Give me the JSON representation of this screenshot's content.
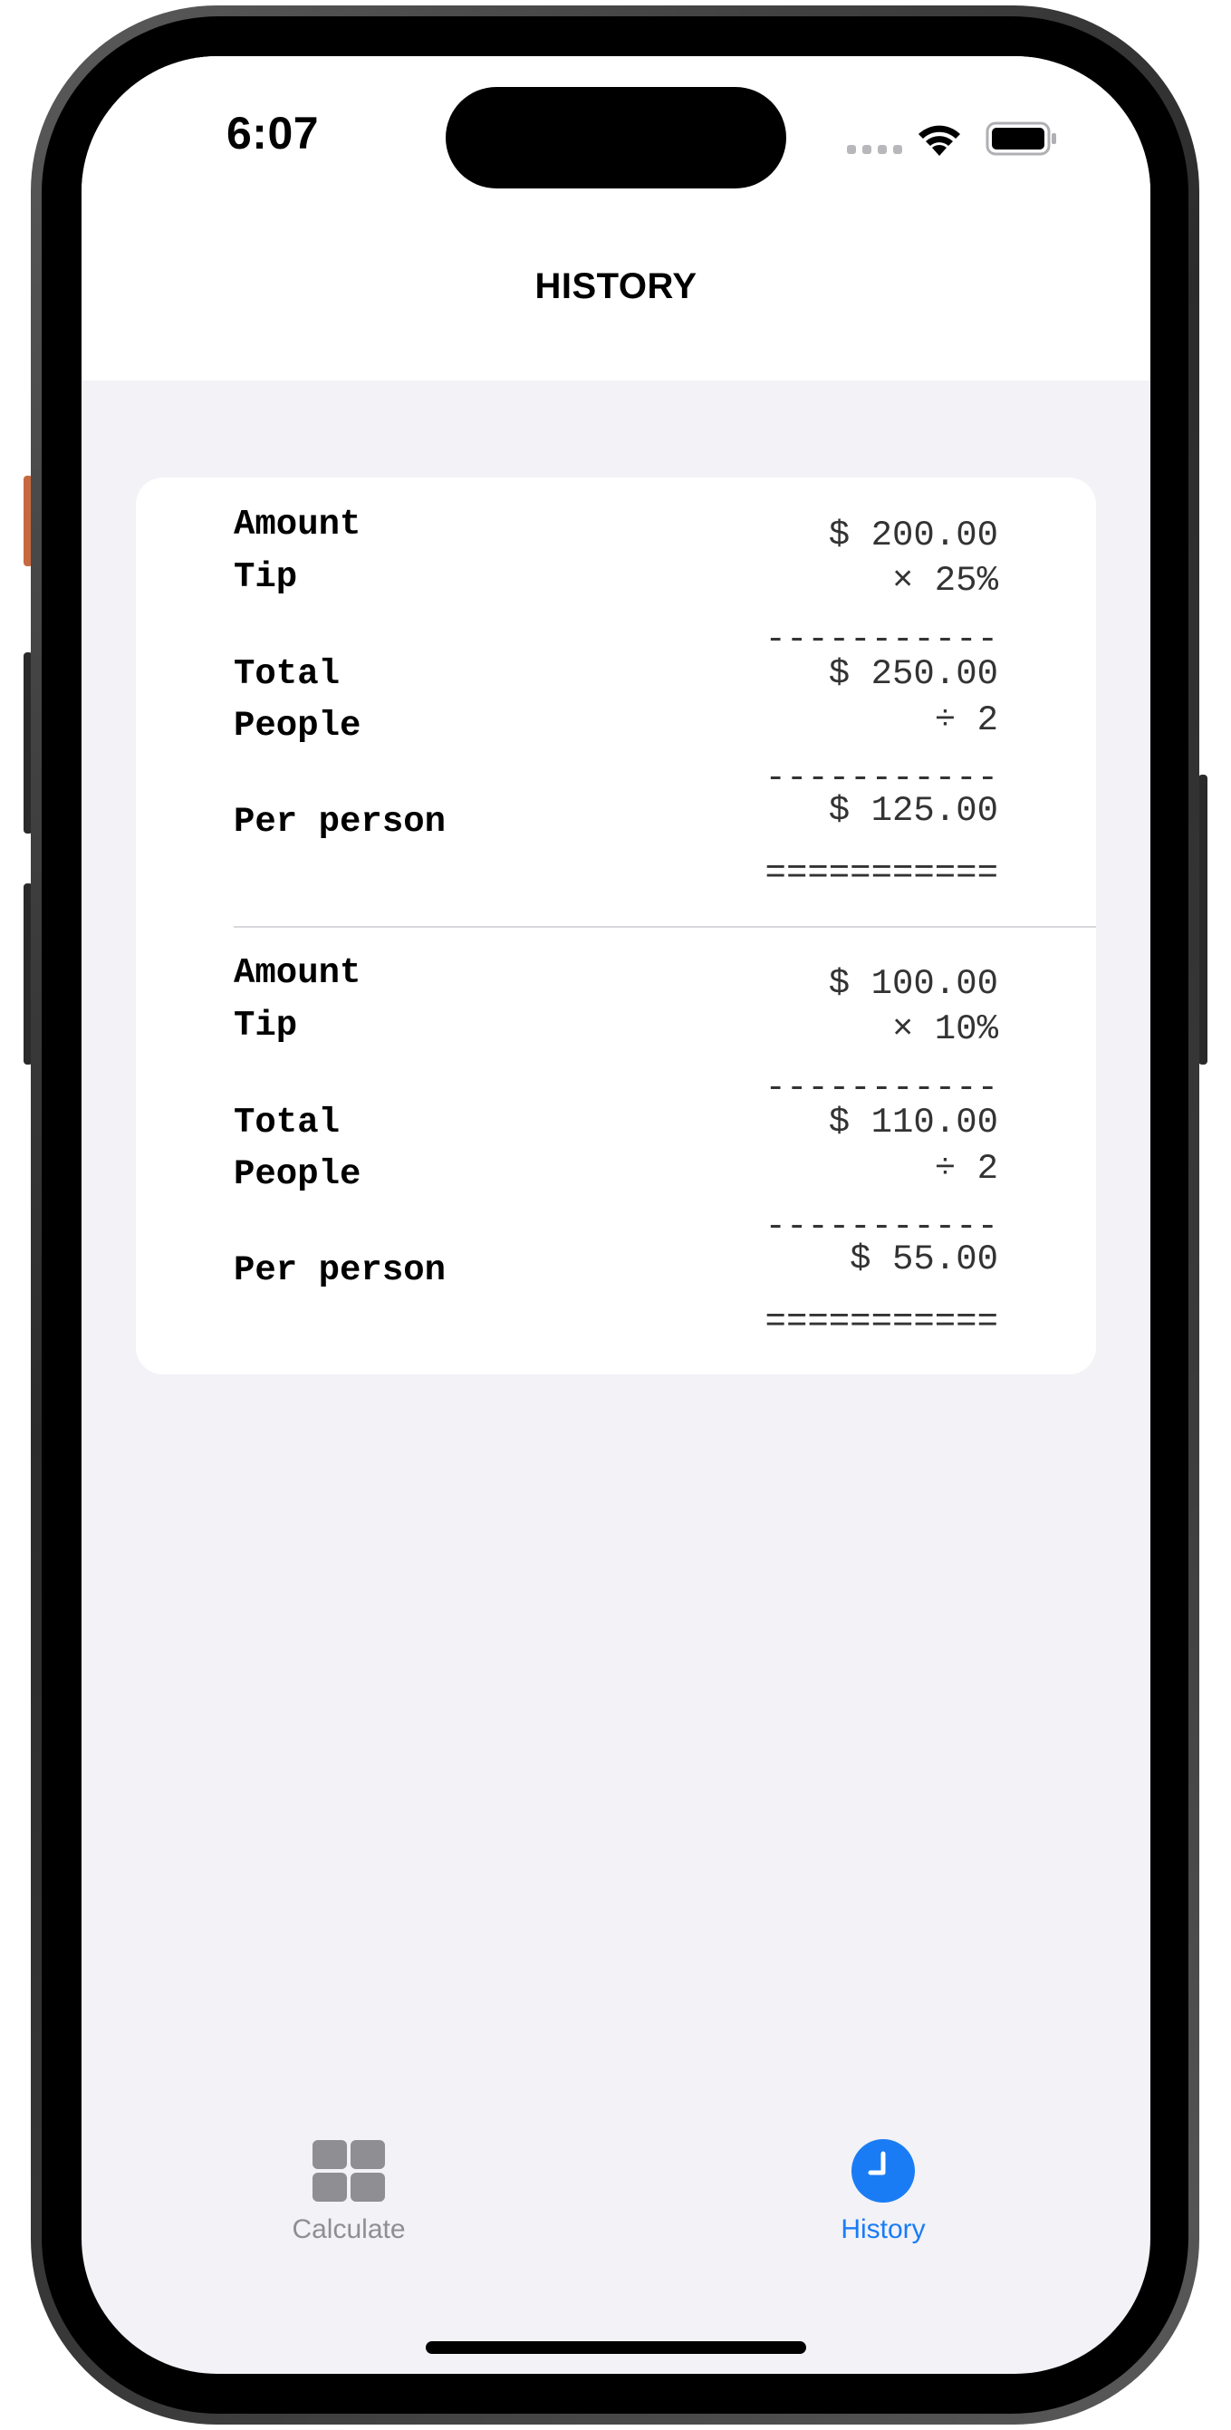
{
  "status_bar": {
    "time": "6:07"
  },
  "header": {
    "title": "HISTORY"
  },
  "history": [
    {
      "amount_label": "Amount",
      "amount_value": "$ 200.00",
      "tip_label": "Tip",
      "tip_value": "× 25%",
      "rule_1": "-----------",
      "total_label": "Total",
      "total_value": "$ 250.00",
      "people_label": "People",
      "people_value": "÷ 2",
      "rule_2": "-----------",
      "per_person_label": "Per person",
      "per_person_value": "$ 125.00",
      "rule_3": "==========="
    },
    {
      "amount_label": "Amount",
      "amount_value": "$ 100.00",
      "tip_label": "Tip",
      "tip_value": "× 10%",
      "rule_1": "-----------",
      "total_label": "Total",
      "total_value": "$ 110.00",
      "people_label": "People",
      "people_value": "÷ 2",
      "rule_2": "-----------",
      "per_person_label": "Per person",
      "per_person_value": "$ 55.00",
      "rule_3": "==========="
    }
  ],
  "tab_bar": {
    "tabs": [
      {
        "label": "Calculate",
        "icon": "grid-icon",
        "selected": false
      },
      {
        "label": "History",
        "icon": "clock-icon",
        "selected": true
      }
    ]
  },
  "colors": {
    "accent": "#1a7cf5",
    "inactive": "#8e8e93",
    "background": "#f2f2f7",
    "card": "#ffffff"
  }
}
